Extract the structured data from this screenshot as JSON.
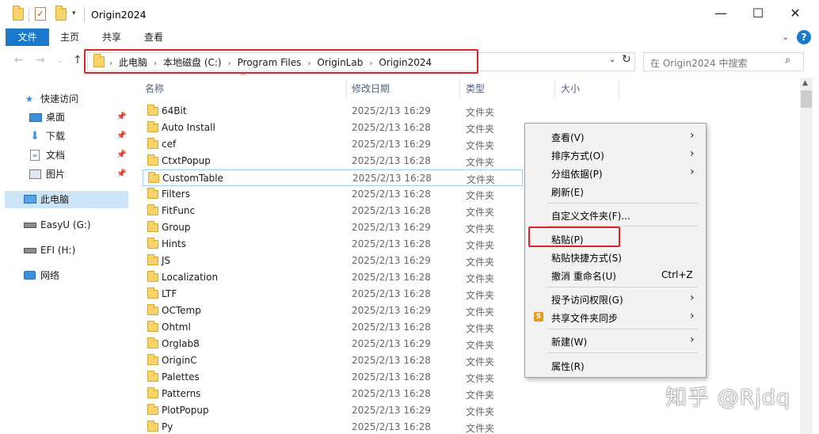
{
  "window": {
    "title": "Origin2024",
    "controls": {
      "minimize": "—",
      "maximize": "☐",
      "close": "✕"
    }
  },
  "ribbon": {
    "file_tab": "文件",
    "tabs": [
      "主页",
      "共享",
      "查看"
    ],
    "help": "?"
  },
  "address": {
    "crumbs": [
      "此电脑",
      "本地磁盘 (C:)",
      "Program Files",
      "OriginLab",
      "Origin2024"
    ],
    "separator": "›"
  },
  "search": {
    "placeholder": "在 Origin2024 中搜索"
  },
  "nav": {
    "items": [
      {
        "label": "快速访问",
        "icon": "star-icon"
      },
      {
        "label": "桌面",
        "icon": "desktop-icon",
        "pinned": true
      },
      {
        "label": "下载",
        "icon": "download-icon",
        "pinned": true
      },
      {
        "label": "文档",
        "icon": "document-icon",
        "pinned": true
      },
      {
        "label": "图片",
        "icon": "picture-icon",
        "pinned": true
      },
      {
        "label": "此电脑",
        "icon": "computer-icon",
        "selected": true
      },
      {
        "label": "EasyU (G:)",
        "icon": "drive-icon"
      },
      {
        "label": "EFI (H:)",
        "icon": "drive-icon"
      },
      {
        "label": "网络",
        "icon": "network-icon"
      }
    ]
  },
  "columns": {
    "name": "名称",
    "date": "修改日期",
    "type": "类型",
    "size": "大小"
  },
  "files": [
    {
      "name": "64Bit",
      "date": "2025/2/13 16:29",
      "type": "文件夹"
    },
    {
      "name": "Auto Install",
      "date": "2025/2/13 16:28",
      "type": "文件夹"
    },
    {
      "name": "cef",
      "date": "2025/2/13 16:29",
      "type": "文件夹"
    },
    {
      "name": "CtxtPopup",
      "date": "2025/2/13 16:28",
      "type": "文件夹"
    },
    {
      "name": "CustomTable",
      "date": "2025/2/13 16:28",
      "type": "文件夹",
      "selected": true
    },
    {
      "name": "Filters",
      "date": "2025/2/13 16:28",
      "type": "文件夹"
    },
    {
      "name": "FitFunc",
      "date": "2025/2/13 16:28",
      "type": "文件夹"
    },
    {
      "name": "Group",
      "date": "2025/2/13 16:29",
      "type": "文件夹"
    },
    {
      "name": "Hints",
      "date": "2025/2/13 16:28",
      "type": "文件夹"
    },
    {
      "name": "JS",
      "date": "2025/2/13 16:29",
      "type": "文件夹"
    },
    {
      "name": "Localization",
      "date": "2025/2/13 16:28",
      "type": "文件夹"
    },
    {
      "name": "LTF",
      "date": "2025/2/13 16:28",
      "type": "文件夹"
    },
    {
      "name": "OCTemp",
      "date": "2025/2/13 16:29",
      "type": "文件夹"
    },
    {
      "name": "Ohtml",
      "date": "2025/2/13 16:28",
      "type": "文件夹"
    },
    {
      "name": "Orglab8",
      "date": "2025/2/13 16:29",
      "type": "文件夹"
    },
    {
      "name": "OriginC",
      "date": "2025/2/13 16:28",
      "type": "文件夹"
    },
    {
      "name": "Palettes",
      "date": "2025/2/13 16:28",
      "type": "文件夹"
    },
    {
      "name": "Patterns",
      "date": "2025/2/13 16:28",
      "type": "文件夹"
    },
    {
      "name": "PlotPopup",
      "date": "2025/2/13 16:29",
      "type": "文件夹"
    },
    {
      "name": "Py",
      "date": "2025/2/13 16:28",
      "type": "文件夹"
    }
  ],
  "context_menu": {
    "items": [
      {
        "label": "查看(V)",
        "submenu": true
      },
      {
        "label": "排序方式(O)",
        "submenu": true
      },
      {
        "label": "分组依据(P)",
        "submenu": true
      },
      {
        "label": "刷新(E)"
      },
      {
        "label": "自定义文件夹(F)..."
      },
      {
        "label": "粘贴(P)",
        "highlighted": true
      },
      {
        "label": "粘贴快捷方式(S)"
      },
      {
        "label": "撤消 重命名(U)",
        "shortcut": "Ctrl+Z"
      },
      {
        "label": "授予访问权限(G)",
        "submenu": true
      },
      {
        "label": "共享文件夹同步",
        "submenu": true,
        "icon": "S"
      },
      {
        "label": "新建(W)",
        "submenu": true
      },
      {
        "label": "属性(R)"
      }
    ]
  },
  "watermark": "知乎 @Rjdq",
  "colors": {
    "accent": "#1979ca",
    "highlight_red": "#d9222a",
    "selection": "#cce4f7"
  }
}
